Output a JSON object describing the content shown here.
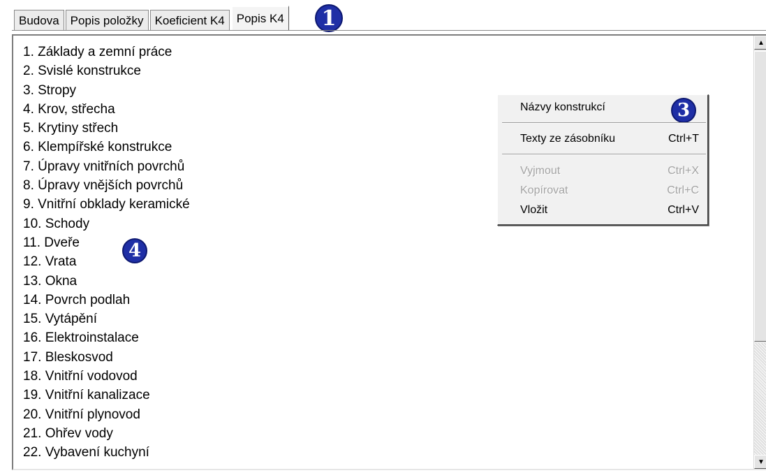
{
  "tabs": [
    {
      "label": "Budova",
      "active": false
    },
    {
      "label": "Popis položky",
      "active": false
    },
    {
      "label": "Koeficient K4",
      "active": false
    },
    {
      "label": "Popis K4",
      "active": true
    }
  ],
  "badges": {
    "tab": "1",
    "menu": "3",
    "list": "4"
  },
  "list_items": [
    "1. Základy a zemní práce",
    "2. Svislé konstrukce",
    "3. Stropy",
    "4. Krov, střecha",
    "5. Krytiny střech",
    "6. Klempířské konstrukce",
    "7. Úpravy vnitřních povrchů",
    "8. Úpravy vnějších povrchů",
    "9. Vnitřní obklady keramické",
    "10. Schody",
    "11. Dveře",
    "12. Vrata",
    "13. Okna",
    "14. Povrch podlah",
    "15. Vytápění",
    "16. Elektroinstalace",
    "17. Bleskosvod",
    "18. Vnitřní vodovod",
    "19. Vnitřní kanalizace",
    "20. Vnitřní plynovod",
    "21. Ohřev vody",
    "22. Vybavení kuchyní"
  ],
  "context_menu": {
    "items": [
      {
        "label": "Názvy konstrukcí",
        "shortcut": "",
        "enabled": true
      },
      {
        "label": "Texty ze zásobníku",
        "shortcut": "Ctrl+T",
        "enabled": true
      },
      {
        "label": "Vyjmout",
        "shortcut": "Ctrl+X",
        "enabled": false
      },
      {
        "label": "Kopírovat",
        "shortcut": "Ctrl+C",
        "enabled": false
      },
      {
        "label": "Vložit",
        "shortcut": "Ctrl+V",
        "enabled": true
      }
    ]
  },
  "scrollbar": {
    "up_glyph": "▲",
    "down_glyph": "▼"
  },
  "colors": {
    "badge": "#1f2fa6",
    "disabled_text": "#a3a3a3",
    "menu_bg": "#f1f1f1"
  }
}
